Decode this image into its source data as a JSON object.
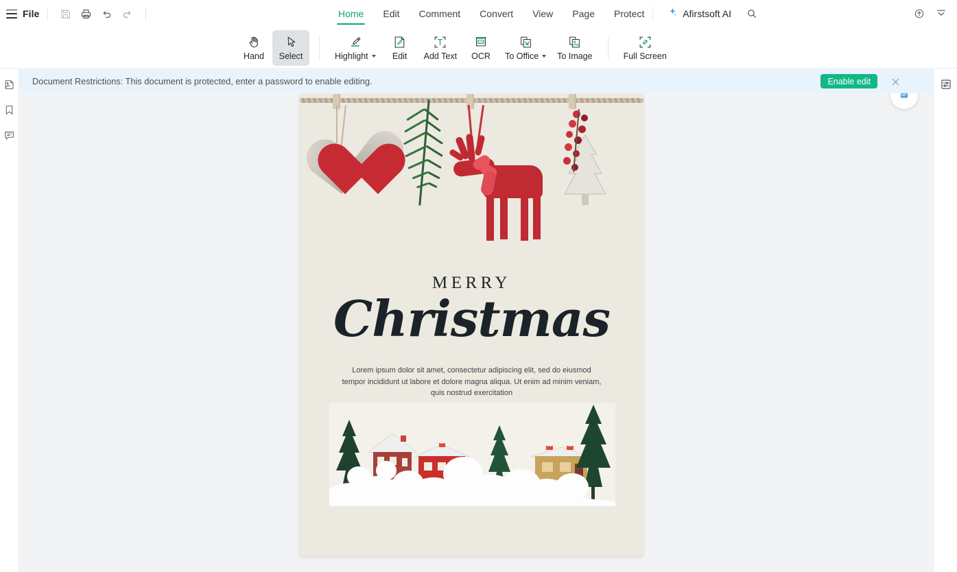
{
  "menubar": {
    "hamburger_icon": "hamburger-icon",
    "file_label": "File",
    "quick_actions": [
      {
        "name": "save-icon",
        "title": "Save"
      },
      {
        "name": "print-icon",
        "title": "Print"
      },
      {
        "name": "undo-icon",
        "title": "Undo"
      },
      {
        "name": "redo-icon",
        "title": "Redo"
      }
    ],
    "tabs": [
      {
        "label": "Home",
        "active": true
      },
      {
        "label": "Edit",
        "active": false
      },
      {
        "label": "Comment",
        "active": false
      },
      {
        "label": "Convert",
        "active": false
      },
      {
        "label": "View",
        "active": false
      },
      {
        "label": "Page",
        "active": false
      },
      {
        "label": "Protect",
        "active": false
      }
    ],
    "ai_label": "Afirstsoft AI",
    "search_icon": "search-icon",
    "cloud_icon": "cloud-upload-icon",
    "collapse_icon": "collapse-ribbon-icon"
  },
  "ribbon": {
    "tools": [
      {
        "label": "Hand",
        "icon": "hand-icon",
        "selected": false,
        "dropdown": false
      },
      {
        "label": "Select",
        "icon": "cursor-arrow-icon",
        "selected": true,
        "dropdown": false
      },
      {
        "label": "Highlight",
        "icon": "highlighter-icon",
        "selected": false,
        "dropdown": true
      },
      {
        "label": "Edit",
        "icon": "edit-pencil-icon",
        "selected": false,
        "dropdown": false
      },
      {
        "label": "Add Text",
        "icon": "add-text-icon",
        "selected": false,
        "dropdown": false
      },
      {
        "label": "OCR",
        "icon": "ocr-icon",
        "selected": false,
        "dropdown": false
      },
      {
        "label": "To Office",
        "icon": "to-office-icon",
        "selected": false,
        "dropdown": true
      },
      {
        "label": "To Image",
        "icon": "to-image-icon",
        "selected": false,
        "dropdown": false
      },
      {
        "label": "Full Screen",
        "icon": "full-screen-icon",
        "selected": false,
        "dropdown": false
      }
    ]
  },
  "left_rail": [
    {
      "name": "thumbnails-icon"
    },
    {
      "name": "bookmark-icon"
    },
    {
      "name": "comment-icon"
    }
  ],
  "right_rail": [
    {
      "name": "properties-panel-icon"
    }
  ],
  "banner": {
    "message": "Document Restrictions: This document is protected, enter a password to enable editing.",
    "enable_label": "Enable edit",
    "close_icon": "close-icon",
    "background": "#e9f3fb",
    "button_color": "#12b886"
  },
  "document": {
    "page_background": "#ece9e0",
    "heading_small": "MERRY",
    "heading_script": "Christmas",
    "body_text": "Lorem ipsum dolor sit amet, consectetur adipiscing elit, sed do eiusmod tempor incididunt ut labore et dolore magna aliqua. Ut enim ad minim veniam, quis nostrud exercitation",
    "top_artwork": "hanging-christmas-ornaments-heart-pine-reindeer-tree",
    "bottom_artwork": "snow-village-with-red-houses-and-pine-trees"
  },
  "colors": {
    "accent_green": "#10a37f",
    "banner_blue": "#e9f3fb",
    "canvas_gray": "#f2f3f5"
  }
}
